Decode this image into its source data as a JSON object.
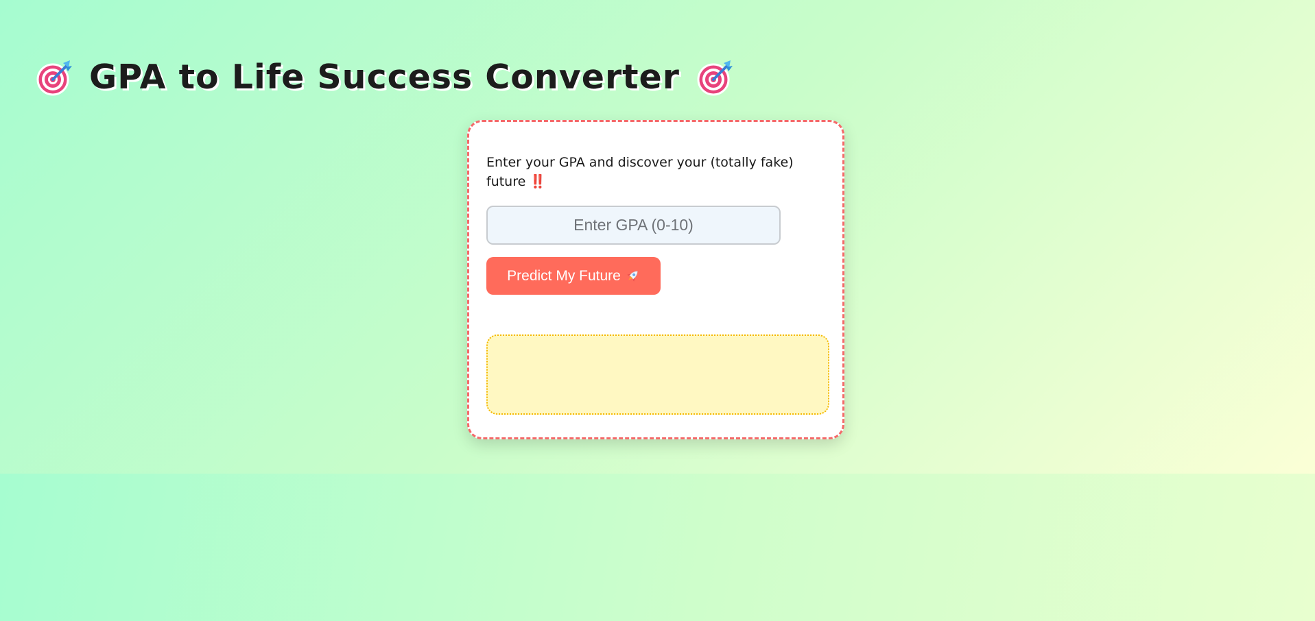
{
  "header": {
    "title": "GPA to Life Success Converter",
    "left_icon": "target-icon",
    "right_icon": "target-icon"
  },
  "card": {
    "intro_text": "Enter your GPA and discover your (totally fake) future ‼️",
    "gpa_input": {
      "value": "",
      "placeholder": "Enter GPA (0-10)"
    },
    "predict_button": {
      "label": "Predict My Future",
      "icon": "rocket-icon"
    },
    "result_text": ""
  },
  "colors": {
    "accent": "#ff6b5b",
    "card_border": "#f46a6a",
    "result_bg": "#fff8c2",
    "result_border": "#f5b800"
  }
}
